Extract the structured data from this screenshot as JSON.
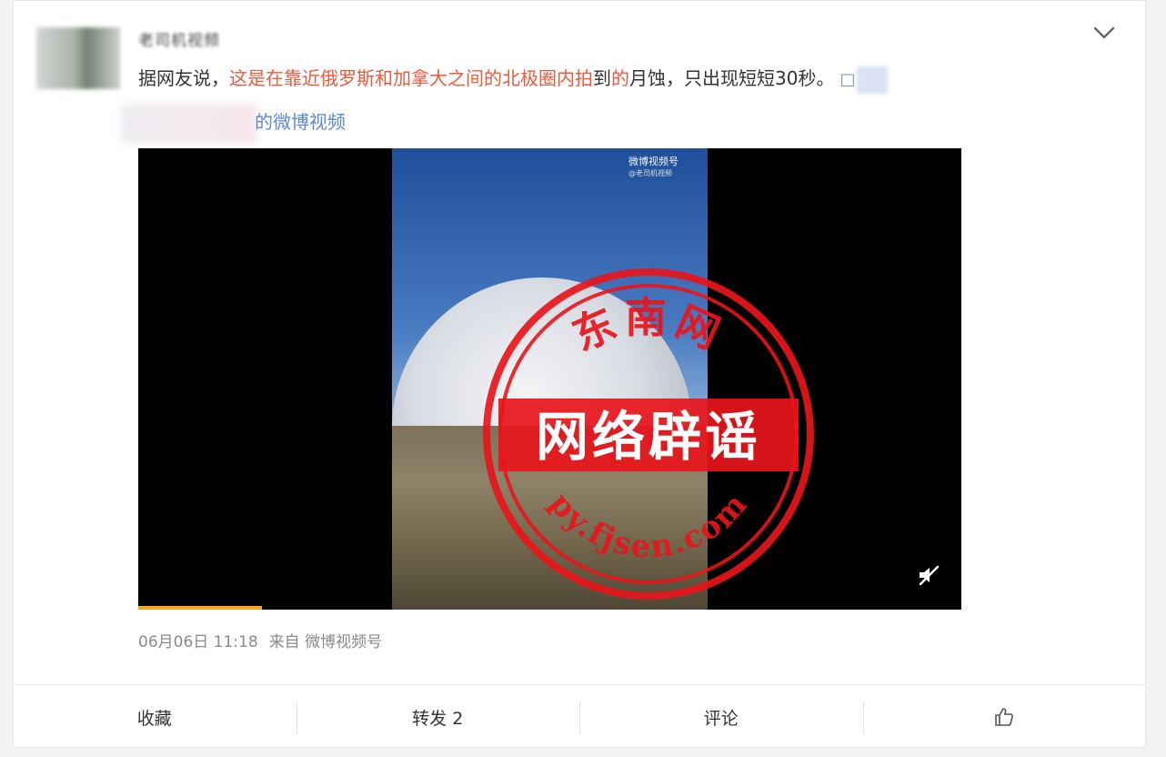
{
  "author": {
    "name": "老司机视频"
  },
  "post": {
    "text_prefix": "据网友说，",
    "text_highlight_1": "这是在靠近俄罗斯和加拿大之间的北极圈内拍",
    "text_mid": "到",
    "text_highlight_2": "的",
    "text_suffix": "月蚀，只出现短短30秒。",
    "link_icon": "□",
    "source_link": "的微博视频"
  },
  "video": {
    "watermark_title": "微博视频号",
    "watermark_sub": "@老司机视频",
    "progress": 0.15,
    "muted": true
  },
  "stamp": {
    "top_text": "东南网",
    "center_text": "网络辟谣",
    "bottom_text": "py.fjsen.com"
  },
  "meta": {
    "date": "06月06日 11:18",
    "source": "来自 微博视频号"
  },
  "actions": {
    "favorite": "收藏",
    "repost": "转发 2",
    "comment": "评论"
  },
  "colors": {
    "highlight": "#eb5a3c",
    "link": "#5b87d6",
    "stamp_red": "#e8151b",
    "progress": "#f5a623"
  }
}
